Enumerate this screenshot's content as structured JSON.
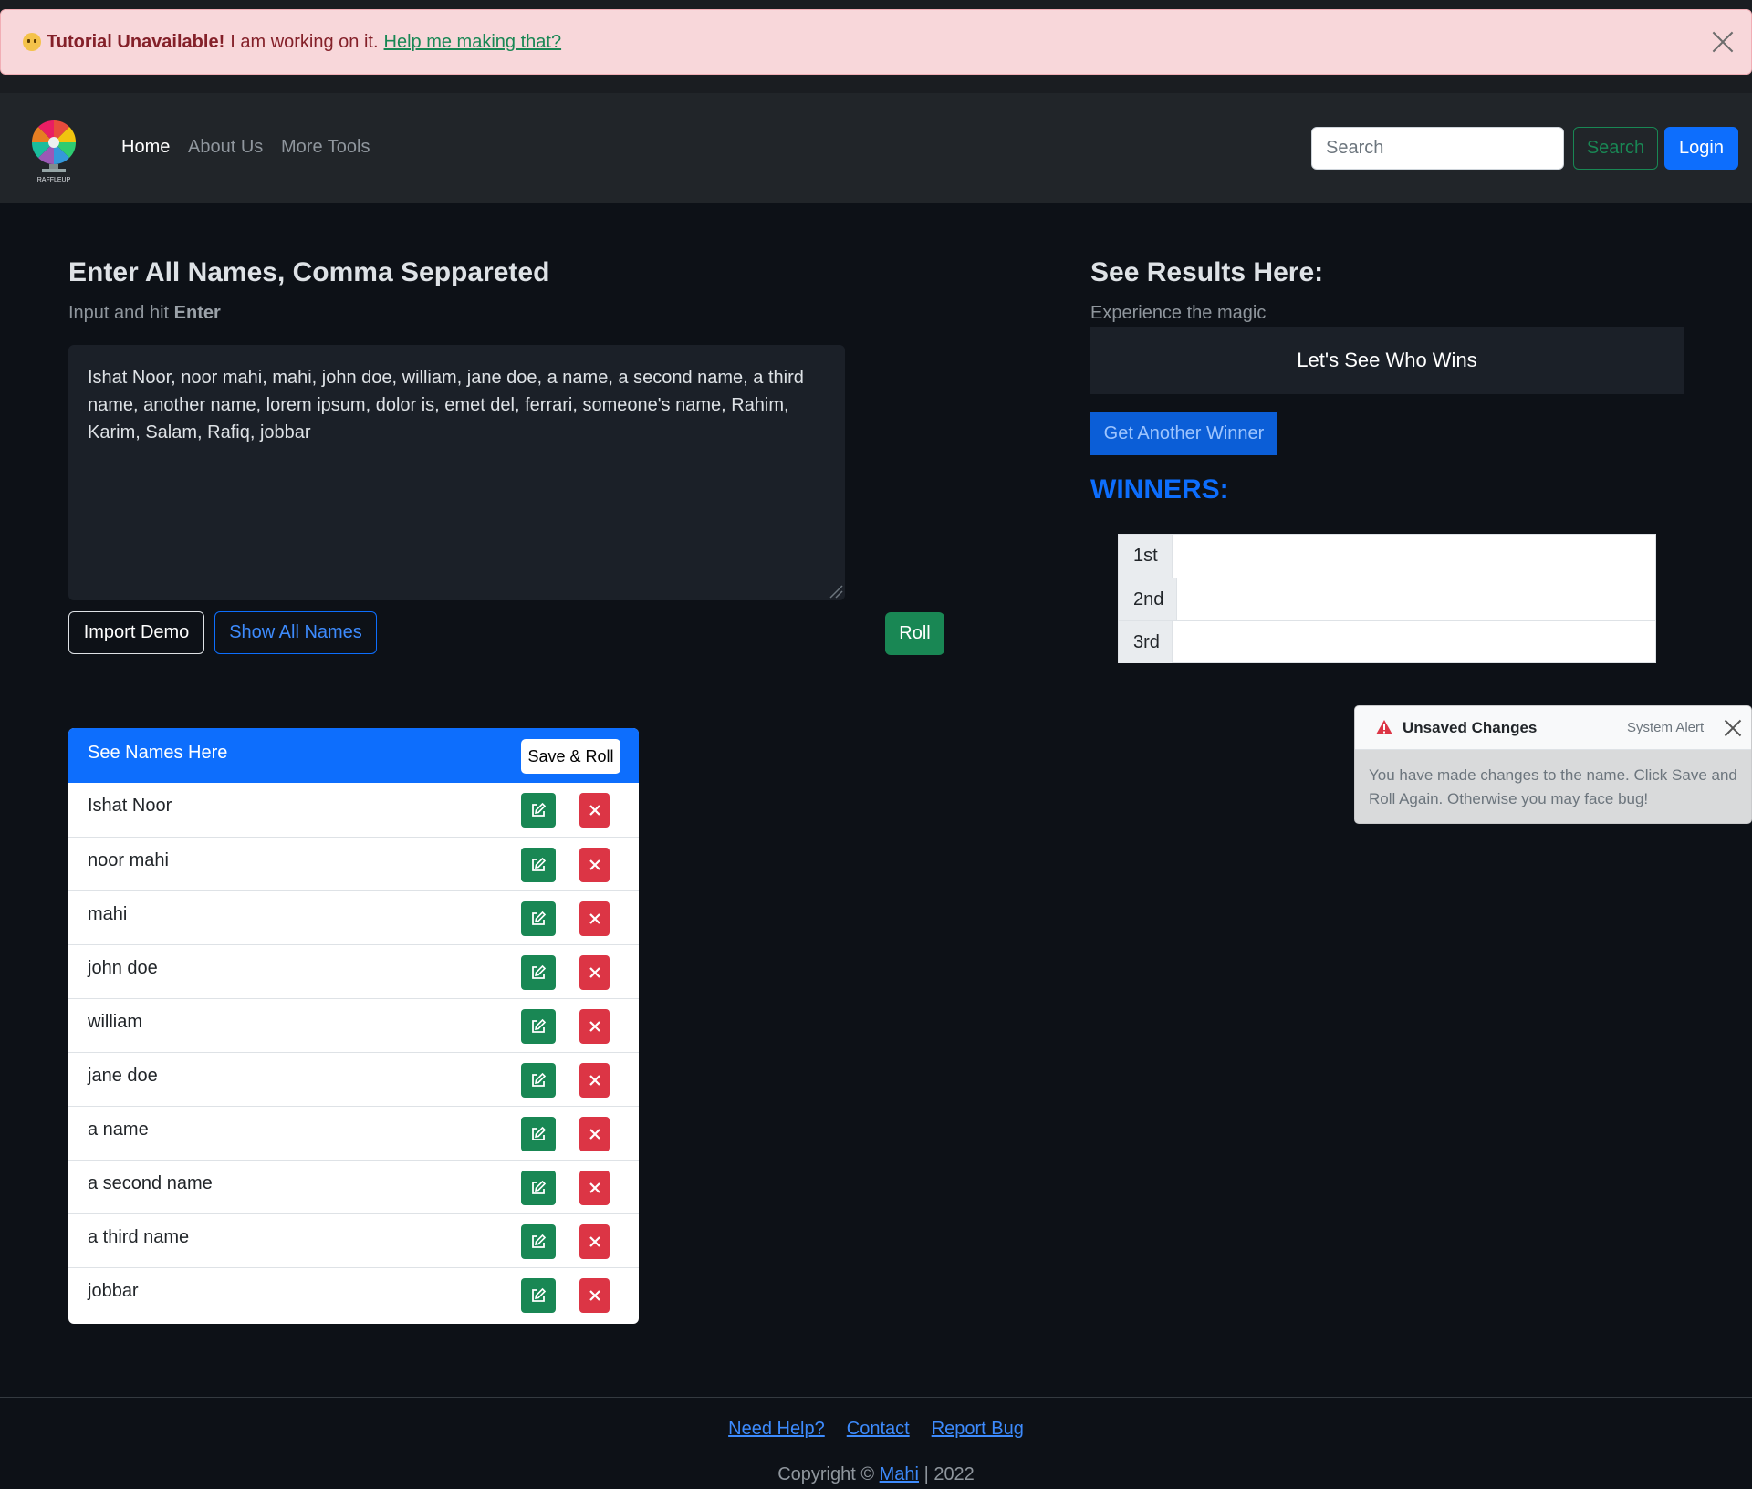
{
  "alert": {
    "strong": "Tutorial Unavailable!",
    "text": "I am working on it.",
    "link": "Help me making that?"
  },
  "nav": {
    "logo_text": "RAFFLEUP",
    "links": [
      "Home",
      "About Us",
      "More Tools"
    ],
    "search_placeholder": "Search",
    "search_button": "Search",
    "login_button": "Login"
  },
  "input_section": {
    "title": "Enter All Names, Comma Seppareted",
    "subtitle_prefix": "Input and hit",
    "subtitle_key": "Enter",
    "textarea_value": "Ishat Noor, noor mahi, mahi, john doe, william, jane doe, a name, a second name, a third name, another name, lorem ipsum, dolor is, emet del, ferrari, someone's name, Rahim, Karim, Salam, Rafiq, jobbar",
    "import_button": "Import Demo",
    "show_all_button": "Show All Names",
    "roll_button": "Roll"
  },
  "names_card": {
    "title": "See Names Here",
    "save_roll_button": "Save & Roll",
    "names": [
      "Ishat Noor",
      "noor mahi",
      "mahi",
      "john doe",
      "william",
      "jane doe",
      "a name",
      "a second name",
      "a third name",
      "jobbar"
    ]
  },
  "results": {
    "title": "See Results Here:",
    "subtitle": "Experience the magic",
    "result_text": "Let's See Who Wins",
    "another_button": "Get Another Winner",
    "winners_label": "WINNERS:",
    "winners": [
      {
        "rank": "1st",
        "name": ""
      },
      {
        "rank": "2nd",
        "name": ""
      },
      {
        "rank": "3rd",
        "name": ""
      }
    ]
  },
  "toast": {
    "title": "Unsaved Changes",
    "source": "System Alert",
    "body": "You have made changes to the name. Click Save and Roll Again. Otherwise you may face bug!"
  },
  "footer": {
    "links": [
      "Need Help?",
      "Contact",
      "Report Bug"
    ],
    "copyright_prefix": "Copyright ©",
    "author": "Mahi",
    "copyright_suffix": "| 2022"
  },
  "colors": {
    "primary": "#0d6efd",
    "success": "#198754",
    "danger": "#dc3545",
    "background": "#0d1117"
  }
}
